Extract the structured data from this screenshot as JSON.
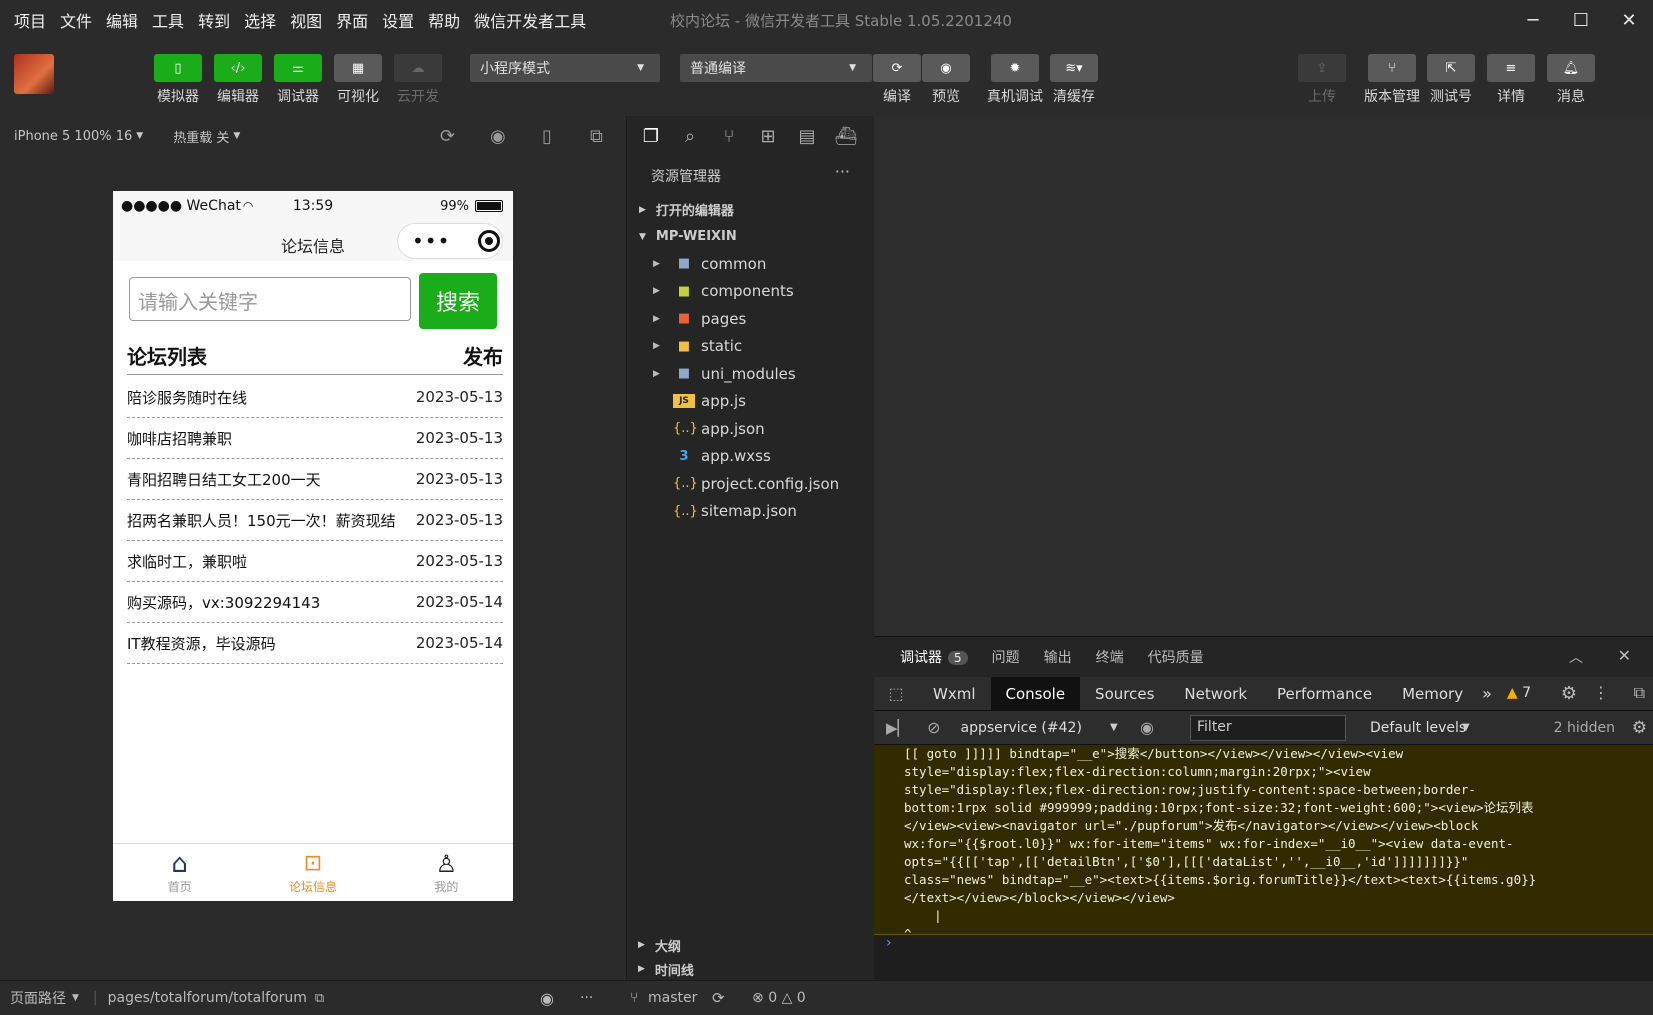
{
  "menubar": {
    "items": [
      "项目",
      "文件",
      "编辑",
      "工具",
      "转到",
      "选择",
      "视图",
      "界面",
      "设置",
      "帮助",
      "微信开发者工具"
    ],
    "window_title": "校内论坛 - 微信开发者工具 Stable 1.05.2201240"
  },
  "toolbar": {
    "simulator": "模拟器",
    "editor": "编辑器",
    "debugger": "调试器",
    "visual": "可视化",
    "cloud": "云开发",
    "mode_select": "小程序模式",
    "compile_select": "普通编译",
    "compile": "编译",
    "preview": "预览",
    "real_debug": "真机调试",
    "clear_cache": "清缓存",
    "upload": "上传",
    "version": "版本管理",
    "test_id": "测试号",
    "details": "详情",
    "messages": "消息"
  },
  "subbar": {
    "device": "iPhone 5 100% 16",
    "hot_reload": "热重载 关"
  },
  "phone": {
    "carrier": "●●●●● WeChat",
    "time": "13:59",
    "battery": "99%",
    "nav_title": "论坛信息",
    "search_placeholder": "请输入关键字",
    "search_button": "搜索",
    "list_title": "论坛列表",
    "publish": "发布",
    "rows": [
      {
        "title": "陪诊服务随时在线",
        "date": "2023-05-13"
      },
      {
        "title": "咖啡店招聘兼职",
        "date": "2023-05-13"
      },
      {
        "title": "青阳招聘日结工女工200一天",
        "date": "2023-05-13"
      },
      {
        "title": "招两名兼职人员！150元一次！薪资现结",
        "date": "2023-05-13"
      },
      {
        "title": "求临时工，兼职啦",
        "date": "2023-05-13"
      },
      {
        "title": "购买源码，vx:3092294143",
        "date": "2023-05-14"
      },
      {
        "title": "IT教程资源，毕设源码",
        "date": "2023-05-14"
      }
    ],
    "tabs": [
      "首页",
      "论坛信息",
      "我的"
    ]
  },
  "explorer": {
    "title": "资源管理器",
    "open_editors": "打开的编辑器",
    "project": "MP-WEIXIN",
    "tree": [
      {
        "name": "common",
        "type": "folder"
      },
      {
        "name": "components",
        "type": "folder"
      },
      {
        "name": "pages",
        "type": "folder"
      },
      {
        "name": "static",
        "type": "folder"
      },
      {
        "name": "uni_modules",
        "type": "folder"
      },
      {
        "name": "app.js",
        "type": "js"
      },
      {
        "name": "app.json",
        "type": "json"
      },
      {
        "name": "app.wxss",
        "type": "css"
      },
      {
        "name": "project.config.json",
        "type": "json"
      },
      {
        "name": "sitemap.json",
        "type": "json"
      }
    ],
    "outline": "大纲",
    "timeline": "时间线"
  },
  "debug": {
    "tabs": [
      "调试器",
      "问题",
      "输出",
      "终端",
      "代码质量"
    ],
    "debugger_count": "5",
    "devtools_tabs": [
      "Wxml",
      "Console",
      "Sources",
      "Network",
      "Performance",
      "Memory"
    ],
    "warning_count": "7",
    "context": "appservice (#42)",
    "filter_placeholder": "Filter",
    "levels": "Default levels",
    "hidden": "2 hidden",
    "console_lines": [
      "[[ goto ]]]]] bindtap=\"__e\">搜索</button></view></view></view><view",
      "style=\"display:flex;flex-direction:column;margin:20rpx;\"><view",
      "style=\"display:flex;flex-direction:row;justify-content:space-between;border-",
      "bottom:1rpx solid #999999;padding:10rpx;font-size:32;font-weight:600;\"><view>论坛列表",
      "</view><view><navigator url=\"./pupforum\">发布</navigator></view></view><block",
      "wx:for=\"{{$root.l0}}\" wx:for-item=\"items\" wx:for-index=\"__i0__\"><view data-event-",
      "opts=\"{{[['tap',[['detailBtn',['$0'],[[['dataList','',__i0__,'id']]]]]]]}}\"",
      "class=\"news\" bindtap=\"__e\"><text>{{items.$orig.forumTitle}}</text><text>{{items.g0}}",
      "</text></view></block></view></view>",
      "    |",
      "^"
    ]
  },
  "statusbar": {
    "path_label": "页面路径",
    "path": "pages/totalforum/totalforum",
    "branch": "master",
    "errors": "0",
    "warnings": "0"
  }
}
